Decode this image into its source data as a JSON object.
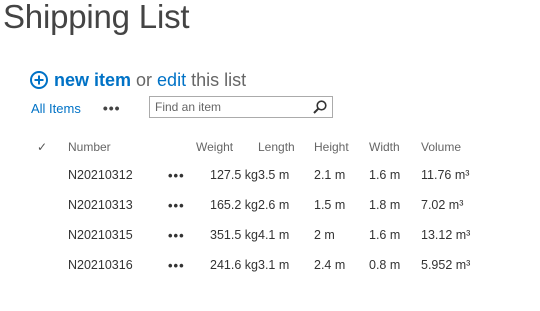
{
  "page": {
    "title": "Shipping List"
  },
  "actions": {
    "new_item_label": "new item",
    "or_text": "or",
    "edit_label": "edit",
    "this_list_text": "this list"
  },
  "views": {
    "current_view": "All Items",
    "more_label": "•••"
  },
  "search": {
    "placeholder": "Find an item"
  },
  "list": {
    "columns": {
      "check": "✓",
      "number": "Number",
      "weight": "Weight",
      "length": "Length",
      "height": "Height",
      "width": "Width",
      "volume": "Volume"
    },
    "row_menu_label": "•••",
    "rows": [
      {
        "number": "N20210312",
        "weight": "127.5 kg",
        "length": "3.5 m",
        "height": "2.1 m",
        "width": "1.6 m",
        "volume": "11.76 m³"
      },
      {
        "number": "N20210313",
        "weight": "165.2 kg",
        "length": "2.6 m",
        "height": "1.5 m",
        "width": "1.8 m",
        "volume": "7.02 m³"
      },
      {
        "number": "N20210315",
        "weight": "351.5 kg",
        "length": "4.1 m",
        "height": "2 m",
        "width": "1.6 m",
        "volume": "13.12 m³"
      },
      {
        "number": "N20210316",
        "weight": "241.6 kg",
        "length": "3.1 m",
        "height": "2.4 m",
        "width": "0.8 m",
        "volume": "5.952 m³"
      }
    ]
  },
  "colors": {
    "accent": "#0072c6",
    "title": "#444444",
    "header_text": "#666666"
  },
  "icons": {
    "new": "plus-circle-icon",
    "search": "search-icon",
    "check": "checkmark-icon",
    "more": "ellipsis-icon"
  }
}
